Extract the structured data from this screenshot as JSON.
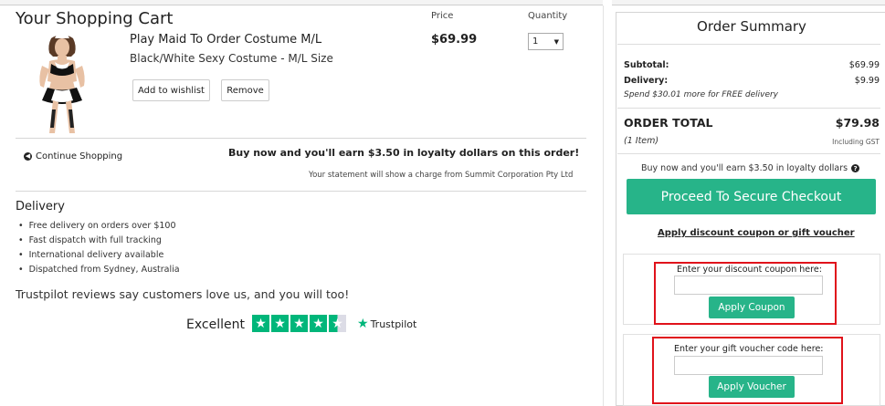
{
  "cart": {
    "title": "Your Shopping Cart",
    "price_header": "Price",
    "quantity_header": "Quantity",
    "product": {
      "name": "Play Maid To Order Costume M/L",
      "variant": "Black/White Sexy Costume - M/L Size",
      "price": "$69.99",
      "quantity": "1"
    },
    "add_to_wishlist": "Add to wishlist",
    "remove": "Remove",
    "continue_shopping": "Continue Shopping",
    "loyalty_message": "Buy now and you'll earn $3.50 in loyalty dollars on this order!",
    "statement": "Your statement will show a charge from Summit Corporation Pty Ltd"
  },
  "delivery": {
    "title": "Delivery",
    "items": [
      "Free delivery on orders over $100",
      "Fast dispatch with full tracking",
      "International delivery available",
      "Dispatched from Sydney, Australia"
    ]
  },
  "trustpilot": {
    "tagline": "Trustpilot reviews say customers love us, and you will too!",
    "rating_word": "Excellent",
    "brand": "Trustpilot",
    "stars": 4.5,
    "color": "#00b67a"
  },
  "summary": {
    "title": "Order Summary",
    "subtotal_label": "Subtotal:",
    "subtotal": "$69.99",
    "delivery_label": "Delivery:",
    "delivery": "$9.99",
    "free_delivery_note": "Spend $30.01 more for FREE delivery",
    "order_total_label": "ORDER TOTAL",
    "order_total": "$79.98",
    "items_count": "(1 Item)",
    "gst_note": "Including GST",
    "loyalty_note": "Buy now and you'll earn $3.50 in loyalty dollars",
    "checkout_button": "Proceed To Secure Checkout",
    "discount_link": "Apply discount coupon or gift voucher",
    "coupon_label": "Enter your discount coupon here:",
    "coupon_button": "Apply Coupon",
    "voucher_label": "Enter your gift voucher code here:",
    "voucher_button": "Apply Voucher"
  },
  "colors": {
    "accent_green": "#27b489",
    "highlight_red": "#e0121b"
  }
}
